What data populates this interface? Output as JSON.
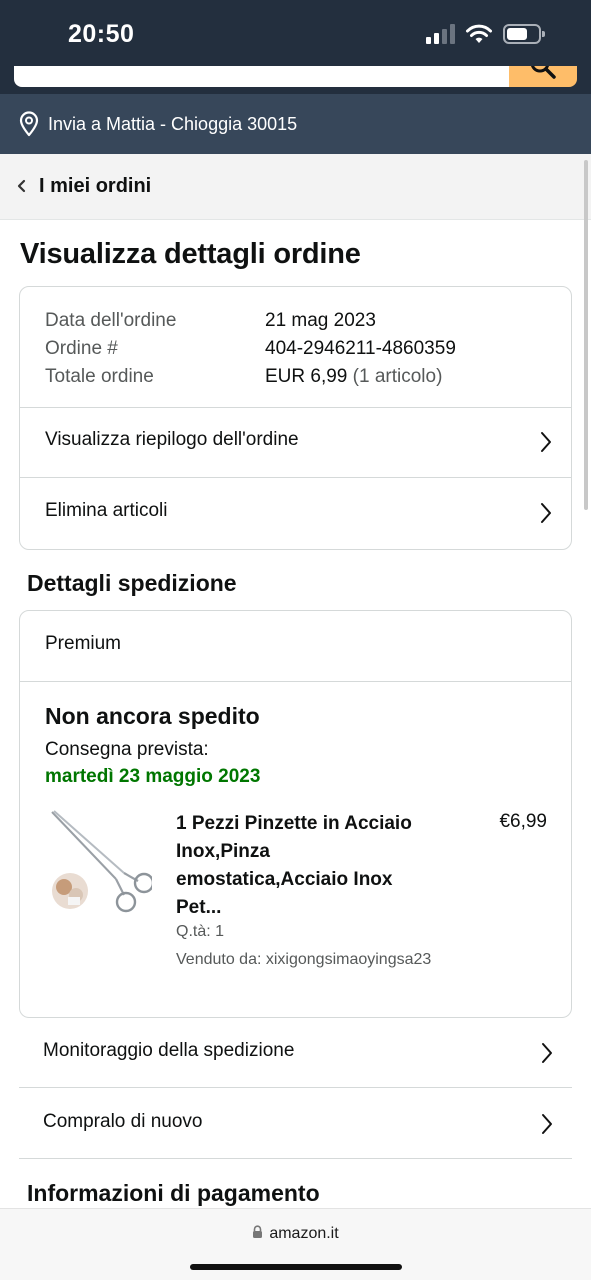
{
  "status_bar": {
    "time": "20:50"
  },
  "header": {
    "deliver_to": "Invia a Mattia - Chioggia 30015"
  },
  "nav": {
    "back_label": "I miei ordini"
  },
  "page_title": "Visualizza dettagli ordine",
  "order_summary": {
    "date_label": "Data dell'ordine",
    "date_value": "21 mag 2023",
    "order_label": "Ordine #",
    "order_value": "404-2946211-4860359",
    "total_label": "Totale ordine",
    "total_value": "EUR 6,99",
    "total_items": "(1 articolo)",
    "link_summary": "Visualizza riepilogo dell'ordine",
    "link_delete": "Elimina articoli"
  },
  "shipping": {
    "section_title": "Dettagli spedizione",
    "type": "Premium",
    "status": "Non ancora spedito",
    "delivery_label": "Consegna prevista:",
    "delivery_date": "martedì 23 maggio 2023",
    "item": {
      "title": "1 Pezzi Pinzette in Acciaio Inox,Pinza emostatica,Acciaio Inox Pet...",
      "price": "€6,99",
      "qty": "Q.tà: 1",
      "seller": "Venduto da: xixigongsimaoyingsa23"
    }
  },
  "actions": {
    "track": "Monitoraggio della spedizione",
    "buy_again": "Compralo di nuovo"
  },
  "payment": {
    "section_title": "Informazioni di pagamento"
  },
  "browser": {
    "url": "amazon.it"
  },
  "colors": {
    "header_dark": "#232f3e",
    "deliver_bar": "#37475a",
    "search_button": "#febd69",
    "delivery_green": "#007600"
  }
}
